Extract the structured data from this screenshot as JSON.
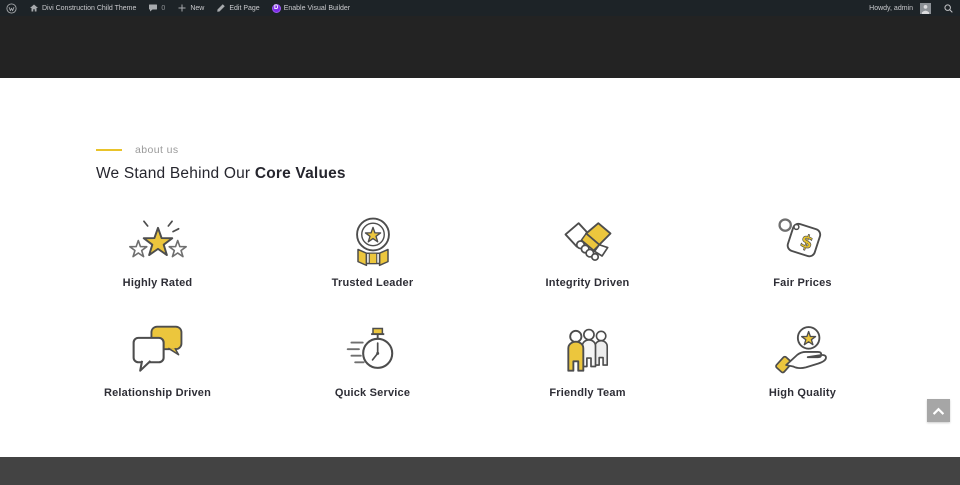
{
  "admin_bar": {
    "site_name": "Divi Construction Child Theme",
    "comments_count": "0",
    "new_label": "New",
    "edit_page_label": "Edit Page",
    "visual_builder_label": "Enable Visual Builder",
    "divi_badge": "D",
    "howdy": "Howdy, admin"
  },
  "about": {
    "eyebrow": "about us",
    "heading_regular": "We Stand Behind Our ",
    "heading_bold": "Core Values",
    "values": [
      {
        "label": "Highly Rated",
        "icon": "stars-icon"
      },
      {
        "label": "Trusted Leader",
        "icon": "medal-icon"
      },
      {
        "label": "Integrity Driven",
        "icon": "handshake-icon"
      },
      {
        "label": "Fair Prices",
        "icon": "price-tag-icon"
      },
      {
        "label": "Relationship Driven",
        "icon": "speech-bubbles-icon"
      },
      {
        "label": "Quick Service",
        "icon": "stopwatch-icon"
      },
      {
        "label": "Friendly Team",
        "icon": "team-icon"
      },
      {
        "label": "High Quality",
        "icon": "hand-star-icon"
      }
    ]
  },
  "colors": {
    "accent_yellow": "#ecc63d",
    "admin_bar_bg": "#1d2327",
    "hero_bg": "#232323",
    "footer_bg": "#434343",
    "heading_color": "#26262e",
    "eyebrow_color": "#9a9a9a",
    "divi_purple": "#7d2ae8",
    "icon_stroke": "#4d4d4d"
  }
}
